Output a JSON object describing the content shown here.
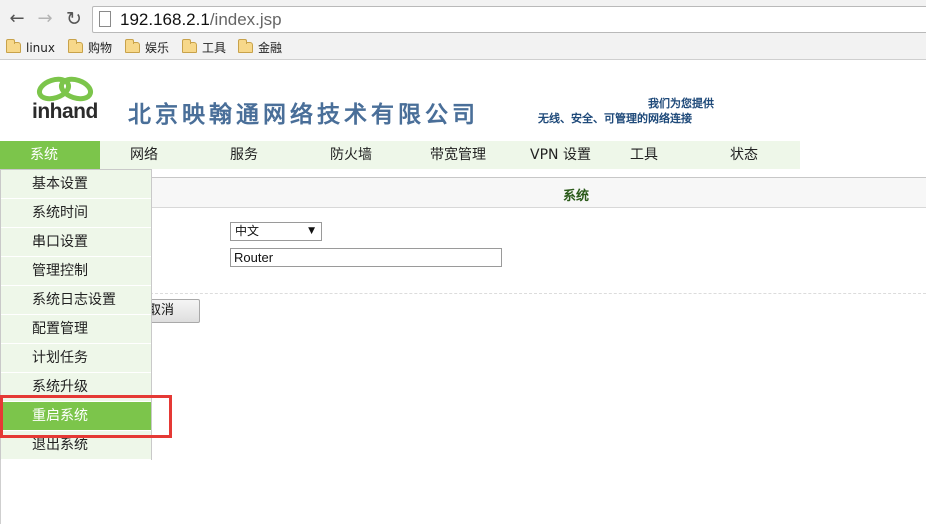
{
  "browser": {
    "url_host": "192.168.2.1",
    "url_path": "/index.jsp",
    "bookmarks": [
      "linux",
      "购物",
      "娱乐",
      "工具",
      "金融"
    ]
  },
  "header": {
    "logo_text": "inhand",
    "company_name": "北京映翰通网络技术有限公司",
    "slogan_line1": "我们为您提供",
    "slogan_line2": "无线、安全、可管理的网络连接",
    "colors": {
      "company": "#4a6f99",
      "logo_green": "#7cc54b"
    }
  },
  "nav": {
    "items": [
      "系统",
      "网络",
      "服务",
      "防火墙",
      "带宽管理",
      "VPN 设置",
      "工具",
      "状态"
    ],
    "active_index": 0,
    "accent_color": "#7cc54b"
  },
  "submenu": {
    "items": [
      "基本设置",
      "系统时间",
      "串口设置",
      "管理控制",
      "系统日志设置",
      "配置管理",
      "计划任务",
      "系统升级",
      "重启系统",
      "退出系统"
    ],
    "highlighted_index": 8
  },
  "content": {
    "section_title": "系统",
    "language_value": "中文",
    "hostname_value": "Router",
    "cancel_label": "取消"
  },
  "annotation": {
    "color": "#e53935"
  }
}
